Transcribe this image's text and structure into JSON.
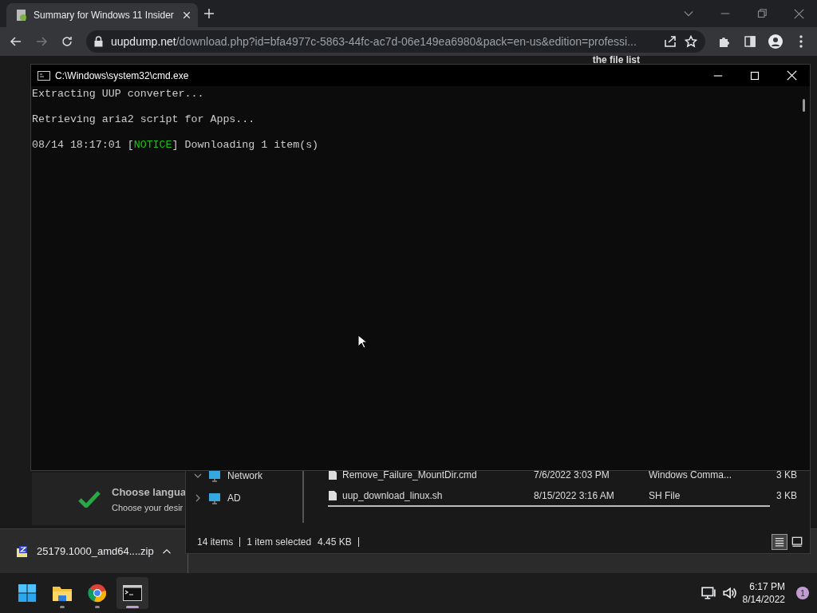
{
  "browser": {
    "tab": {
      "title": "Summary for Windows 11 Insider",
      "selected": true
    },
    "address": {
      "host": "uupdump.net",
      "path": "/download.php?id=bfa4977c-5863-44fc-ac7d-06e149ea6980&pack=en-us&edition=professi..."
    },
    "page": {
      "heading_peek": "the file list",
      "step": {
        "title": "Choose langua",
        "subtitle": "Choose your desir"
      }
    },
    "download": {
      "file": "25179.1000_amd64....zip"
    }
  },
  "console": {
    "title": "C:\\Windows\\system32\\cmd.exe",
    "lines": [
      {
        "segments": [
          {
            "kind": "plain",
            "text": "Extracting UUP converter..."
          }
        ]
      },
      {
        "segments": [
          {
            "kind": "plain",
            "text": "Retrieving aria2 script for Apps..."
          }
        ]
      },
      {
        "segments": [
          {
            "kind": "plain",
            "text": "08/14 18:17:01 ["
          },
          {
            "kind": "notice",
            "text": "NOTICE"
          },
          {
            "kind": "plain",
            "text": "] Downloading 1 item(s)"
          }
        ]
      }
    ]
  },
  "explorer": {
    "nav": [
      {
        "label": "Network",
        "expanded": true
      },
      {
        "label": "AD",
        "expanded": false
      }
    ],
    "files": [
      {
        "name": "Remove_Failure_MountDir.cmd",
        "modified": "7/6/2022 3:03 PM",
        "type": "Windows Comma...",
        "size": "3 KB"
      },
      {
        "name": "uup_download_linux.sh",
        "modified": "8/15/2022 3:16 AM",
        "type": "SH File",
        "size": "3 KB"
      }
    ],
    "status": {
      "count": "14 items",
      "selection": "1 item selected",
      "size": "4.45 KB"
    },
    "views": [
      {
        "kind": "details",
        "selected": true
      },
      {
        "kind": "tiles",
        "selected": false
      }
    ]
  },
  "taskbar": {
    "apps": [
      {
        "kind": "start",
        "active": false
      },
      {
        "kind": "explorer",
        "active": false
      },
      {
        "kind": "chrome",
        "active": false
      },
      {
        "kind": "terminal",
        "active": true
      }
    ],
    "time": "6:17 PM",
    "date": "8/14/2022",
    "notifications": "1"
  }
}
